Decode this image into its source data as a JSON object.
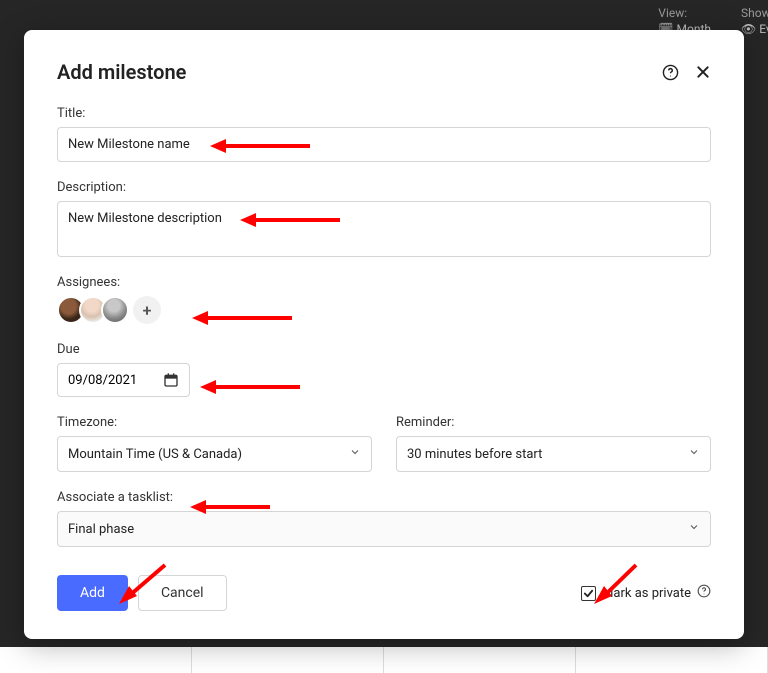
{
  "background": {
    "view_label": "View:",
    "view_value": "Month",
    "show_label": "Show:",
    "show_value": "Eve"
  },
  "modal": {
    "title": "Add milestone",
    "fields": {
      "title_label": "Title:",
      "title_value": "New Milestone name",
      "description_label": "Description:",
      "description_value": "New Milestone description",
      "assignees_label": "Assignees:",
      "due_label": "Due",
      "due_value": "09/08/2021",
      "timezone_label": "Timezone:",
      "timezone_value": "Mountain Time (US & Canada)",
      "reminder_label": "Reminder:",
      "reminder_value": "30 minutes before start",
      "tasklist_label": "Associate a tasklist:",
      "tasklist_value": "Final phase"
    },
    "footer": {
      "add": "Add",
      "cancel": "Cancel",
      "private_label": "Mark as private",
      "private_checked": true
    }
  }
}
